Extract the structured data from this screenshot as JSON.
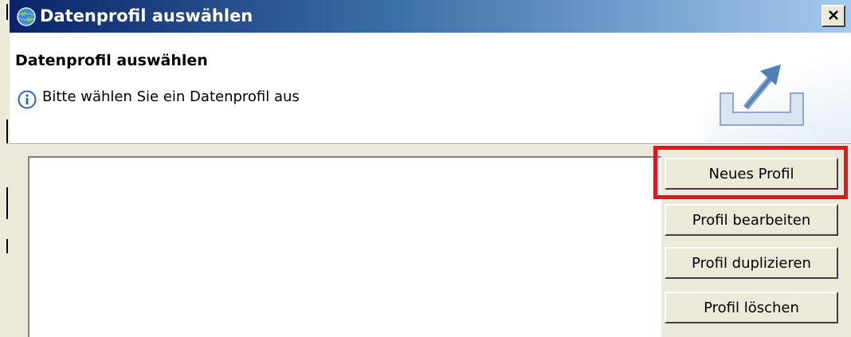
{
  "window": {
    "title": "Datenprofil auswählen",
    "title_icon": "globe-icon",
    "close_icon": "close-icon"
  },
  "banner": {
    "heading": "Datenprofil auswählen",
    "message": "Bitte wählen Sie ein Datenprofil aus",
    "message_icon": "info-icon",
    "graphic_icon": "export-tray-icon"
  },
  "profile_list": {
    "items": []
  },
  "buttons": {
    "new_profile": "Neues Profil",
    "edit_profile": "Profil bearbeiten",
    "duplicate_profile": "Profil duplizieren",
    "delete_profile": "Profil löschen"
  },
  "colors": {
    "highlight": "#e8141c",
    "titlebar_start": "#0a246a",
    "titlebar_end": "#a6caf0",
    "dialog_face": "#ece9d8"
  }
}
